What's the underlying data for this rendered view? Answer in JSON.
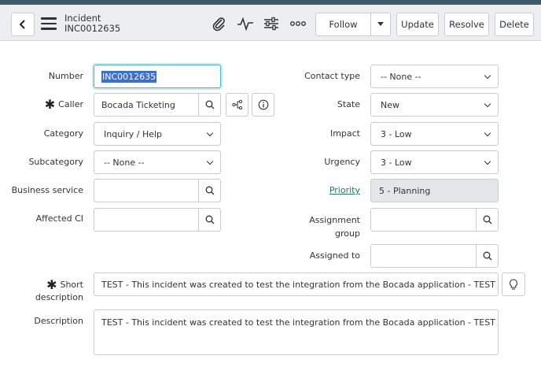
{
  "header": {
    "title": "Incident",
    "number": "INC0012635",
    "follow_label": "Follow",
    "update_label": "Update",
    "resolve_label": "Resolve",
    "delete_label": "Delete"
  },
  "form": {
    "number": {
      "label": "Number",
      "value": "INC0012635"
    },
    "caller": {
      "label": "Caller",
      "value": "Bocada Ticketing"
    },
    "category": {
      "label": "Category",
      "value": "Inquiry / Help"
    },
    "subcategory": {
      "label": "Subcategory",
      "value": "-- None --"
    },
    "business_service": {
      "label": "Business service",
      "value": ""
    },
    "affected_ci": {
      "label": "Affected CI",
      "value": ""
    },
    "contact_type": {
      "label": "Contact type",
      "value": "-- None --"
    },
    "state": {
      "label": "State",
      "value": "New"
    },
    "impact": {
      "label": "Impact",
      "value": "3 - Low"
    },
    "urgency": {
      "label": "Urgency",
      "value": "3 - Low"
    },
    "priority": {
      "label": "Priority",
      "value": "5 - Planning"
    },
    "assignment_group": {
      "label_line1": "Assignment",
      "label_line2": "group",
      "value": ""
    },
    "assigned_to": {
      "label": "Assigned to",
      "value": ""
    },
    "short_description": {
      "label_line1": "Short",
      "label_line2": "description",
      "value": "TEST - This incident was created to test the integration from the Bocada application - TEST"
    },
    "description": {
      "label": "Description",
      "value": "TEST - This incident was created to test the integration from the Bocada application - TEST"
    }
  },
  "colors": {
    "accent": "#4bb5c6",
    "link": "#1f7a6e",
    "header_bg": "#eceeef",
    "selection": "#3a6fd8"
  }
}
